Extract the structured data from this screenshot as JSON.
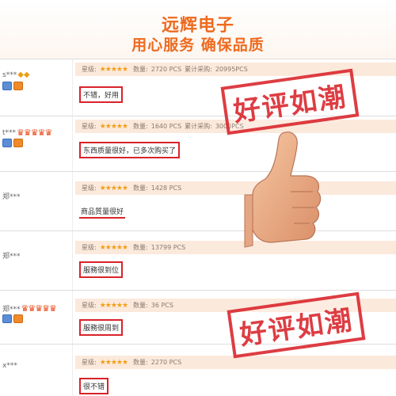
{
  "header": {
    "title": "远辉电子",
    "subtitle": "用心服务 确保品质"
  },
  "labels": {
    "rating": "星级:",
    "quantity": "数量:",
    "cumulative": "累计采购:"
  },
  "reviews": [
    {
      "user": "s***",
      "badge_icons": "gem",
      "quantity": "2720 PCS",
      "cumulative": "20995PCS",
      "comment": "不错，好用"
    },
    {
      "user": "t***",
      "badge_icons": "crowns",
      "quantity": "1640 PCS",
      "cumulative": "3000PCS",
      "comment": "东西质量很好，已多次购买了"
    },
    {
      "user": "郑***",
      "badge_icons": "",
      "quantity": "1428 PCS",
      "cumulative": "",
      "comment": "商品質量很好"
    },
    {
      "user": "郑***",
      "badge_icons": "",
      "quantity": "13799 PCS",
      "cumulative": "",
      "comment": "服務很到位"
    },
    {
      "user": "郑***",
      "badge_icons": "crowns",
      "quantity": "36 PCS",
      "cumulative": "",
      "comment": "服務很周到"
    },
    {
      "user": "x***",
      "badge_icons": "",
      "quantity": "2270 PCS",
      "cumulative": "",
      "comment": "很不错"
    }
  ],
  "stamps": {
    "top": "好评如潮",
    "bottom": "好评如潮"
  },
  "colors": {
    "accent": "#ee6b1f",
    "stamp_red": "#d9232a",
    "info_bar": "#fbe9dc",
    "star": "#f0a11a"
  },
  "icons": [
    "thumbs-up-icon",
    "star-icon",
    "crown-icon",
    "diamond-icon",
    "id-badge-icon",
    "vip-badge-icon"
  ]
}
